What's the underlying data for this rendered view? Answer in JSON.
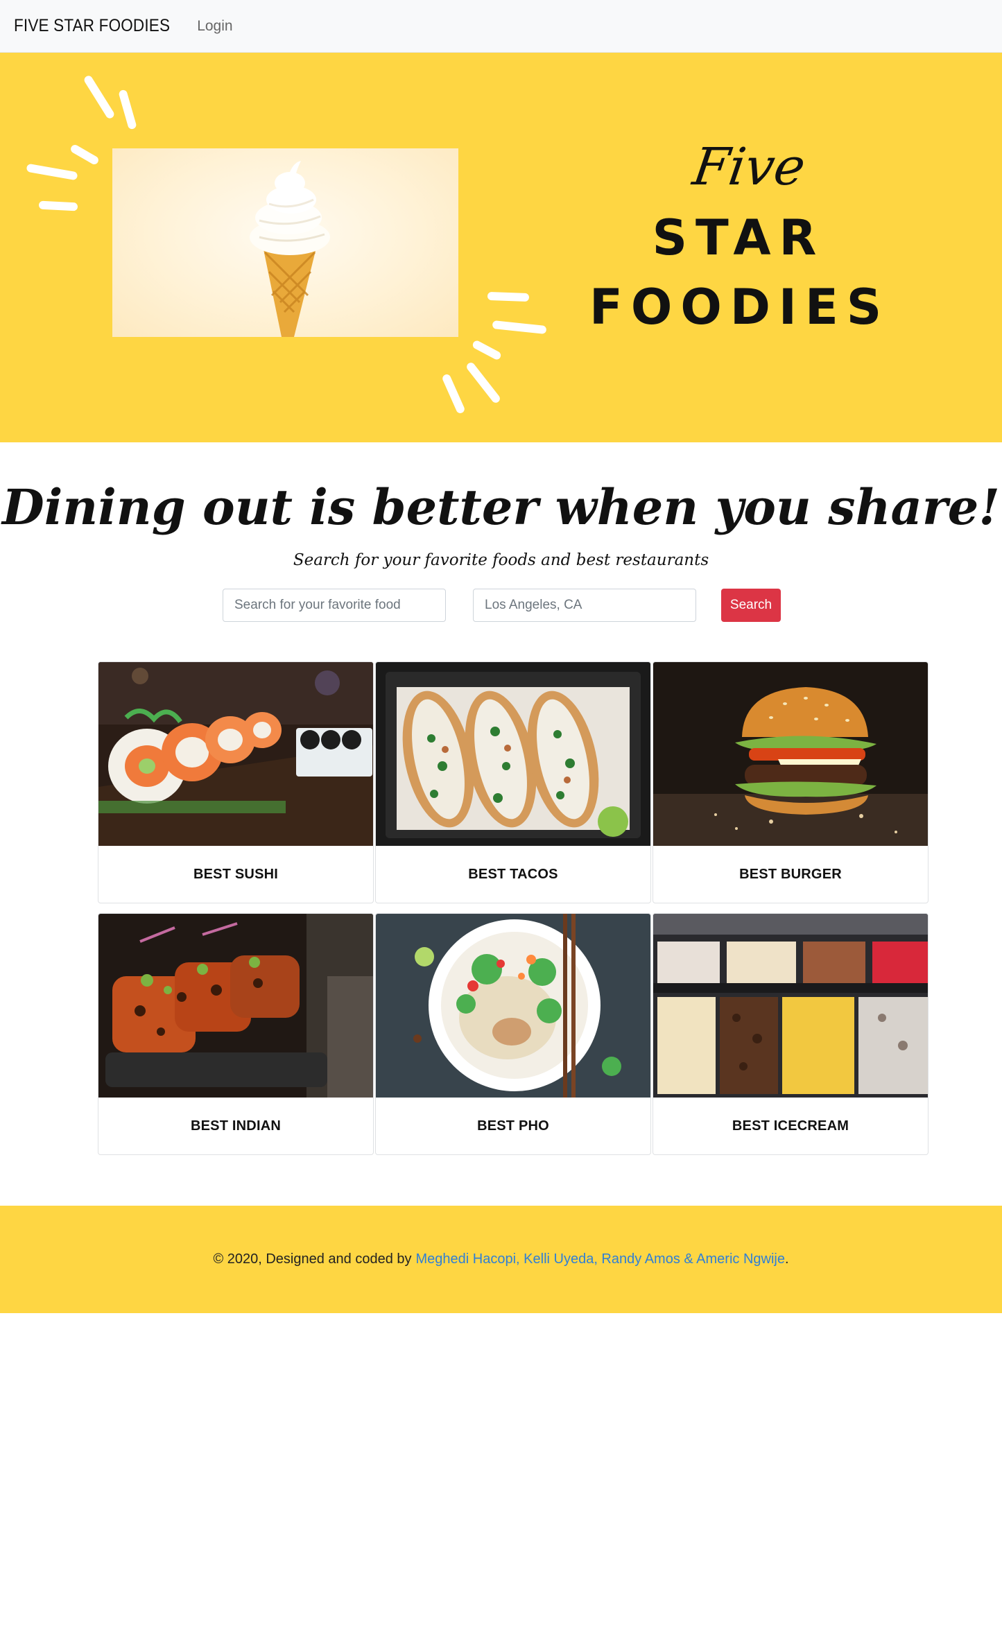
{
  "navbar": {
    "brand": "FIVE STAR FOODIES",
    "login_label": "Login"
  },
  "hero": {
    "logo_line1": "Five",
    "logo_line2": "STAR",
    "logo_line3": "FOODIES",
    "background_color": "#fed643"
  },
  "intro": {
    "tagline": "Dining out is better when you share!",
    "subtitle": "Search for your favorite foods and best restaurants"
  },
  "search": {
    "food_placeholder": "Search for your favorite food",
    "location_placeholder": "Los Angeles, CA",
    "button_label": "Search",
    "button_color": "#dc3545"
  },
  "cards": [
    {
      "label": "BEST SUSHI"
    },
    {
      "label": "BEST TACOS"
    },
    {
      "label": "BEST BURGER"
    },
    {
      "label": "BEST INDIAN"
    },
    {
      "label": "BEST PHO"
    },
    {
      "label": "BEST ICECREAM"
    }
  ],
  "footer": {
    "credit_prefix": "© 2020, Designed and coded by",
    "authors": "Meghedi Hacopi, Kelli Uyeda, Randy Amos & Americ Ngwije",
    "suffix": ".",
    "link_color": "#2f7fd6"
  }
}
